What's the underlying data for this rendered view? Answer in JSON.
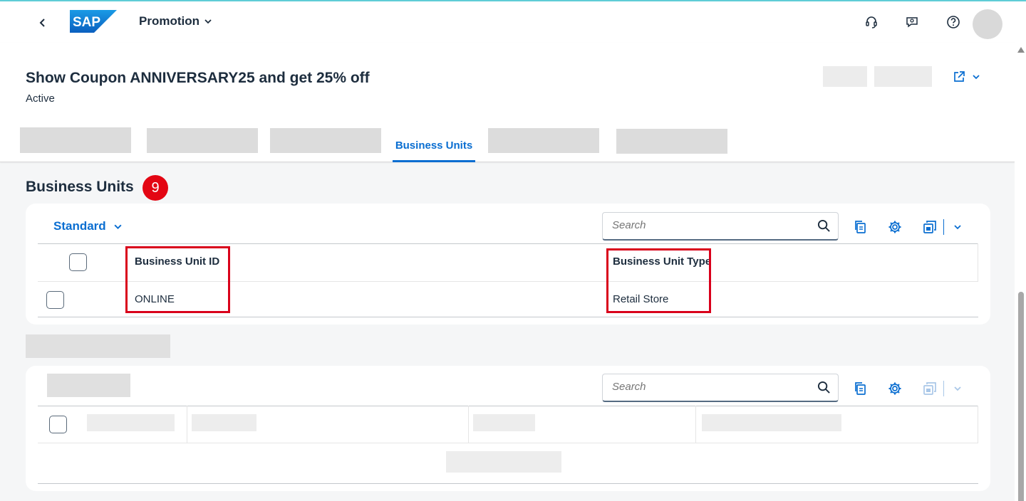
{
  "shell": {
    "app_title": "Promotion",
    "logo_text": "SAP"
  },
  "header": {
    "object_title": "Show Coupon ANNIVERSARY25 and get 25% off",
    "status": "Active"
  },
  "tabs": {
    "active_label": "Business Units"
  },
  "section": {
    "title": "Business Units",
    "step_number": "9"
  },
  "table1": {
    "variant": "Standard",
    "search_placeholder": "Search",
    "columns": [
      "Business Unit ID",
      "Business Unit Type"
    ],
    "rows": [
      {
        "id": "ONLINE",
        "type": "Retail Store"
      }
    ]
  },
  "table2": {
    "search_placeholder": "Search"
  },
  "colors": {
    "accent": "#0a6ed1",
    "highlight": "#d9001b",
    "badge": "#e30613"
  }
}
